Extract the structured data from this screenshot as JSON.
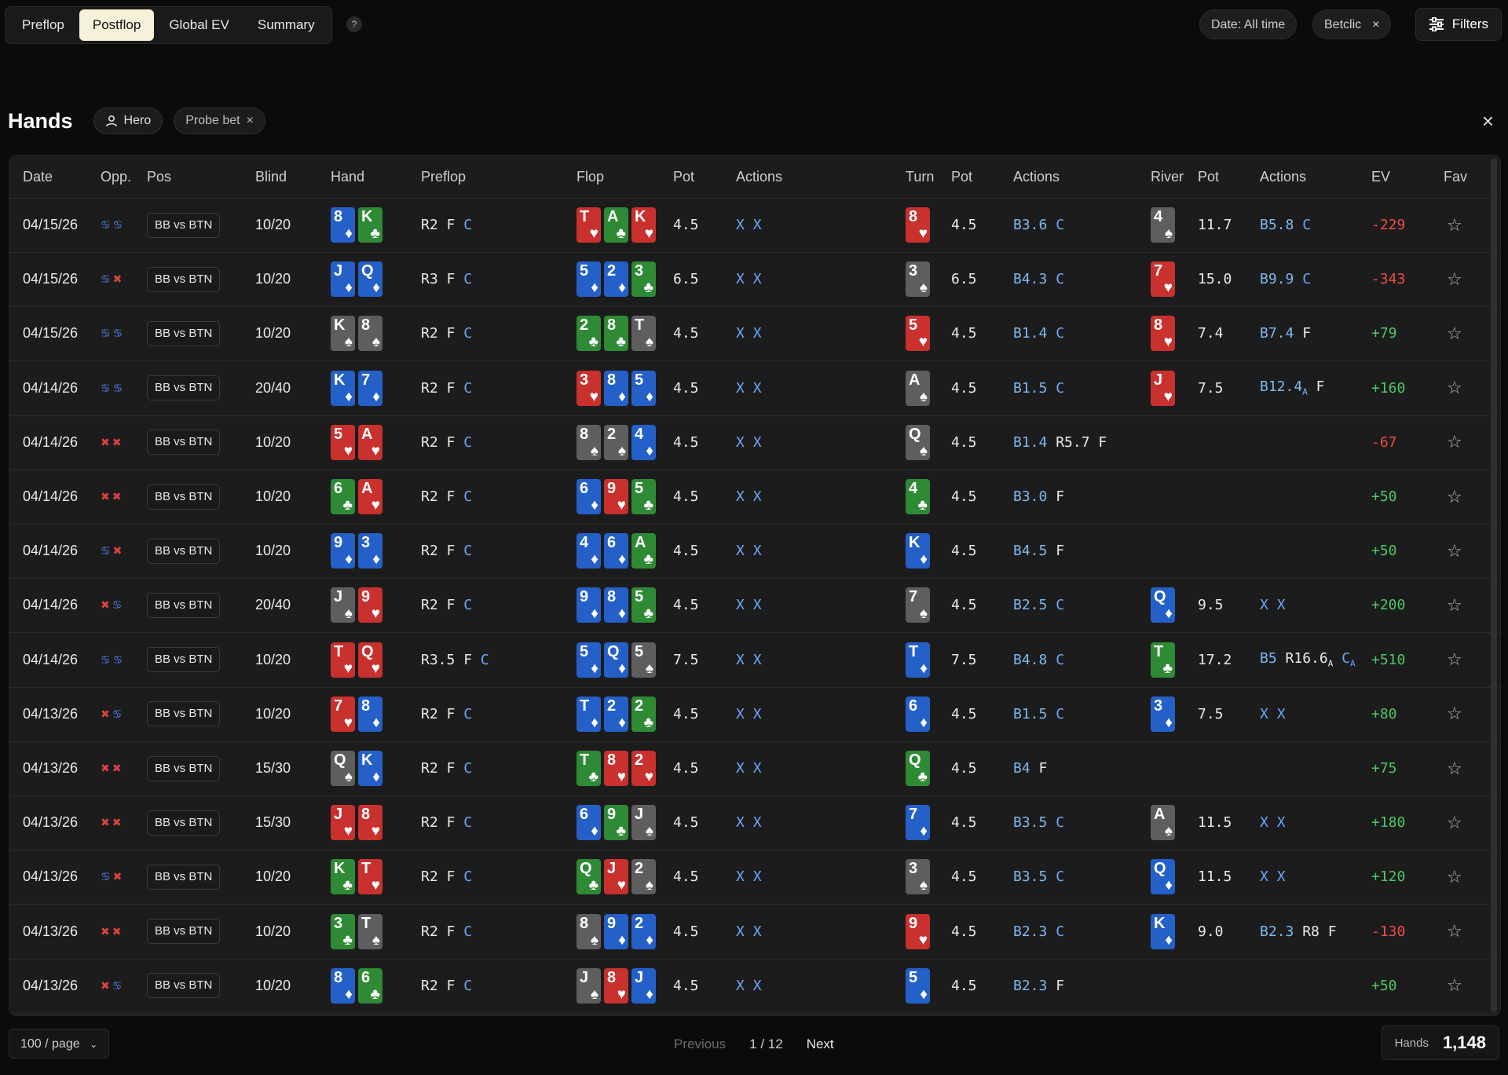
{
  "tabs": [
    "Preflop",
    "Postflop",
    "Global EV",
    "Summary"
  ],
  "active_tab": 1,
  "help_label": "?",
  "filters": {
    "date": "Date: All time",
    "site": "Betclic",
    "site_remove": "×",
    "button": "Filters"
  },
  "hands": {
    "title": "Hands",
    "chip_player": "Hero",
    "chip_filter": "Probe bet",
    "chip_remove": "×",
    "close": "×"
  },
  "columns": [
    "Date",
    "Opp.",
    "Pos",
    "Blind",
    "Hand",
    "Preflop",
    "Flop",
    "Pot",
    "Actions",
    "Turn",
    "Pot",
    "Actions",
    "River",
    "Pot",
    "Actions",
    "EV",
    "Fav"
  ],
  "colors": {
    "hearts": "#c8312e",
    "diamonds": "#2560c8",
    "clubs": "#2f8a35",
    "spades": "#5e5e5e",
    "positive": "#4cc764",
    "negative": "#ef4d46"
  },
  "rows": [
    {
      "date": "04/15/26",
      "opp": "bb",
      "pos": "BB vs BTN",
      "blind": "10/20",
      "hand": [
        "8d",
        "Kc"
      ],
      "pre": "R2 F C",
      "flop": [
        "Th",
        "Ac",
        "Kh"
      ],
      "fpot": "4.5",
      "fact": "X X",
      "turn": "8h",
      "tpot": "4.5",
      "tact": "B3.6 C",
      "river": "4s",
      "rpot": "11.7",
      "ract": "B5.8 C",
      "ev": "-229"
    },
    {
      "date": "04/15/26",
      "opp": "br",
      "pos": "BB vs BTN",
      "blind": "10/20",
      "hand": [
        "Jd",
        "Qd"
      ],
      "pre": "R3 F C",
      "flop": [
        "5d",
        "2d",
        "3c"
      ],
      "fpot": "6.5",
      "fact": "X X",
      "turn": "3s",
      "tpot": "6.5",
      "tact": "B4.3 C",
      "river": "7h",
      "rpot": "15.0",
      "ract": "B9.9 C",
      "ev": "-343"
    },
    {
      "date": "04/15/26",
      "opp": "bb",
      "pos": "BB vs BTN",
      "blind": "10/20",
      "hand": [
        "Ks",
        "8s"
      ],
      "pre": "R2 F C",
      "flop": [
        "2c",
        "8c",
        "Ts"
      ],
      "fpot": "4.5",
      "fact": "X X",
      "turn": "5h",
      "tpot": "4.5",
      "tact": "B1.4 C",
      "river": "8h",
      "rpot": "7.4",
      "ract": "B7.4 F",
      "ev": "+79"
    },
    {
      "date": "04/14/26",
      "opp": "bb",
      "pos": "BB vs BTN",
      "blind": "20/40",
      "hand": [
        "Kd",
        "7d"
      ],
      "pre": "R2 F C",
      "flop": [
        "3h",
        "8d",
        "5d"
      ],
      "fpot": "4.5",
      "fact": "X X",
      "turn": "As",
      "tpot": "4.5",
      "tact": "B1.5 C",
      "river": "Jh",
      "rpot": "7.5",
      "ract": "B12.4A F",
      "ev": "+160"
    },
    {
      "date": "04/14/26",
      "opp": "rr",
      "pos": "BB vs BTN",
      "blind": "10/20",
      "hand": [
        "5h",
        "Ah"
      ],
      "pre": "R2 F C",
      "flop": [
        "8s",
        "2s",
        "4d"
      ],
      "fpot": "4.5",
      "fact": "X X",
      "turn": "Qs",
      "tpot": "4.5",
      "tact": "B1.4 R5.7 F",
      "river": "",
      "rpot": "",
      "ract": "",
      "ev": "-67"
    },
    {
      "date": "04/14/26",
      "opp": "rr",
      "pos": "BB vs BTN",
      "blind": "10/20",
      "hand": [
        "6c",
        "Ah"
      ],
      "pre": "R2 F C",
      "flop": [
        "6d",
        "9h",
        "5c"
      ],
      "fpot": "4.5",
      "fact": "X X",
      "turn": "4c",
      "tpot": "4.5",
      "tact": "B3.0 F",
      "river": "",
      "rpot": "",
      "ract": "",
      "ev": "+50"
    },
    {
      "date": "04/14/26",
      "opp": "br",
      "pos": "BB vs BTN",
      "blind": "10/20",
      "hand": [
        "9d",
        "3d"
      ],
      "pre": "R2 F C",
      "flop": [
        "4d",
        "6d",
        "Ac"
      ],
      "fpot": "4.5",
      "fact": "X X",
      "turn": "Kd",
      "tpot": "4.5",
      "tact": "B4.5 F",
      "river": "",
      "rpot": "",
      "ract": "",
      "ev": "+50"
    },
    {
      "date": "04/14/26",
      "opp": "rb",
      "pos": "BB vs BTN",
      "blind": "20/40",
      "hand": [
        "Js",
        "9h"
      ],
      "pre": "R2 F C",
      "flop": [
        "9d",
        "8d",
        "5c"
      ],
      "fpot": "4.5",
      "fact": "X X",
      "turn": "7s",
      "tpot": "4.5",
      "tact": "B2.5 C",
      "river": "Qd",
      "rpot": "9.5",
      "ract": "X X",
      "ev": "+200"
    },
    {
      "date": "04/14/26",
      "opp": "bb",
      "pos": "BB vs BTN",
      "blind": "10/20",
      "hand": [
        "Th",
        "Qh"
      ],
      "pre": "R3.5 F C",
      "flop": [
        "5d",
        "Qd",
        "5s"
      ],
      "fpot": "7.5",
      "fact": "X X",
      "turn": "Td",
      "tpot": "7.5",
      "tact": "B4.8 C",
      "river": "Tc",
      "rpot": "17.2",
      "ract": "B5 R16.6A CA",
      "ev": "+510"
    },
    {
      "date": "04/13/26",
      "opp": "rb",
      "pos": "BB vs BTN",
      "blind": "10/20",
      "hand": [
        "7h",
        "8d"
      ],
      "pre": "R2 F C",
      "flop": [
        "Td",
        "2d",
        "2c"
      ],
      "fpot": "4.5",
      "fact": "X X",
      "turn": "6d",
      "tpot": "4.5",
      "tact": "B1.5 C",
      "river": "3d",
      "rpot": "7.5",
      "ract": "X X",
      "ev": "+80"
    },
    {
      "date": "04/13/26",
      "opp": "rr",
      "pos": "BB vs BTN",
      "blind": "15/30",
      "hand": [
        "Qs",
        "Kd"
      ],
      "pre": "R2 F C",
      "flop": [
        "Tc",
        "8h",
        "2h"
      ],
      "fpot": "4.5",
      "fact": "X X",
      "turn": "Qc",
      "tpot": "4.5",
      "tact": "B4 F",
      "river": "",
      "rpot": "",
      "ract": "",
      "ev": "+75"
    },
    {
      "date": "04/13/26",
      "opp": "rr",
      "pos": "BB vs BTN",
      "blind": "15/30",
      "hand": [
        "Jh",
        "8h"
      ],
      "pre": "R2 F C",
      "flop": [
        "6d",
        "9c",
        "Js"
      ],
      "fpot": "4.5",
      "fact": "X X",
      "turn": "7d",
      "tpot": "4.5",
      "tact": "B3.5 C",
      "river": "As",
      "rpot": "11.5",
      "ract": "X X",
      "ev": "+180"
    },
    {
      "date": "04/13/26",
      "opp": "br",
      "pos": "BB vs BTN",
      "blind": "10/20",
      "hand": [
        "Kc",
        "Th"
      ],
      "pre": "R2 F C",
      "flop": [
        "Qc",
        "Jh",
        "2s"
      ],
      "fpot": "4.5",
      "fact": "X X",
      "turn": "3s",
      "tpot": "4.5",
      "tact": "B3.5 C",
      "river": "Qd",
      "rpot": "11.5",
      "ract": "X X",
      "ev": "+120"
    },
    {
      "date": "04/13/26",
      "opp": "rr",
      "pos": "BB vs BTN",
      "blind": "10/20",
      "hand": [
        "3c",
        "Ts"
      ],
      "pre": "R2 F C",
      "flop": [
        "8s",
        "9d",
        "2d"
      ],
      "fpot": "4.5",
      "fact": "X X",
      "turn": "9h",
      "tpot": "4.5",
      "tact": "B2.3 C",
      "river": "Kd",
      "rpot": "9.0",
      "ract": "B2.3 R8 F",
      "ev": "-130"
    },
    {
      "date": "04/13/26",
      "opp": "rb",
      "pos": "BB vs BTN",
      "blind": "10/20",
      "hand": [
        "8d",
        "6c"
      ],
      "pre": "R2 F C",
      "flop": [
        "Js",
        "8h",
        "Jd"
      ],
      "fpot": "4.5",
      "fact": "X X",
      "turn": "5d",
      "tpot": "4.5",
      "tact": "B2.3 F",
      "river": "",
      "rpot": "",
      "ract": "",
      "ev": "+50"
    }
  ],
  "footer": {
    "per_page": "100 / page",
    "previous": "Previous",
    "page_info": "1 / 12",
    "next": "Next",
    "count_label": "Hands",
    "count_value": "1,148"
  }
}
